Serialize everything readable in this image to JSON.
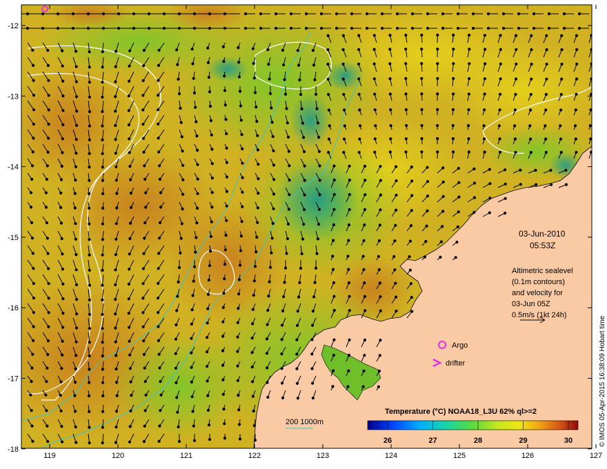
{
  "map": {
    "date": "03-Jun-2010",
    "time": "05:53Z",
    "altimetry_lines": [
      "Altimetric sealevel",
      "(0.1m contours)",
      "and velocity for",
      "03-Jun 05Z",
      "0.5m/s (1kt 24h)"
    ],
    "argo_label": "Argo",
    "drifter_label": "drifter",
    "bathymetry_label": "200  1000m",
    "colorbar_title": "Temperature (°C) NOAA18_L3U 62% ql>=2",
    "colorbar_ticks": [
      "26",
      "27",
      "28",
      "29",
      "30"
    ],
    "credit": "© IMOS 05-Apr-2015 16:38:09 Hobart time",
    "lon_ticks": [
      "119",
      "120",
      "121",
      "122",
      "123",
      "124",
      "125",
      "126",
      "127"
    ],
    "lat_ticks": [
      "-12",
      "-13",
      "-14",
      "-15",
      "-16",
      "-17",
      "-18"
    ],
    "colors": {
      "land": "#f9caa3",
      "warm": "#d9a022",
      "mid": "#d2c21e",
      "cool": "#8ed12a",
      "cold": "#2aa58c",
      "contour": "#ffffff",
      "bathymetry": "#39c6c6",
      "argo": "#e62ee6",
      "drifter": "#e62ee6"
    }
  }
}
